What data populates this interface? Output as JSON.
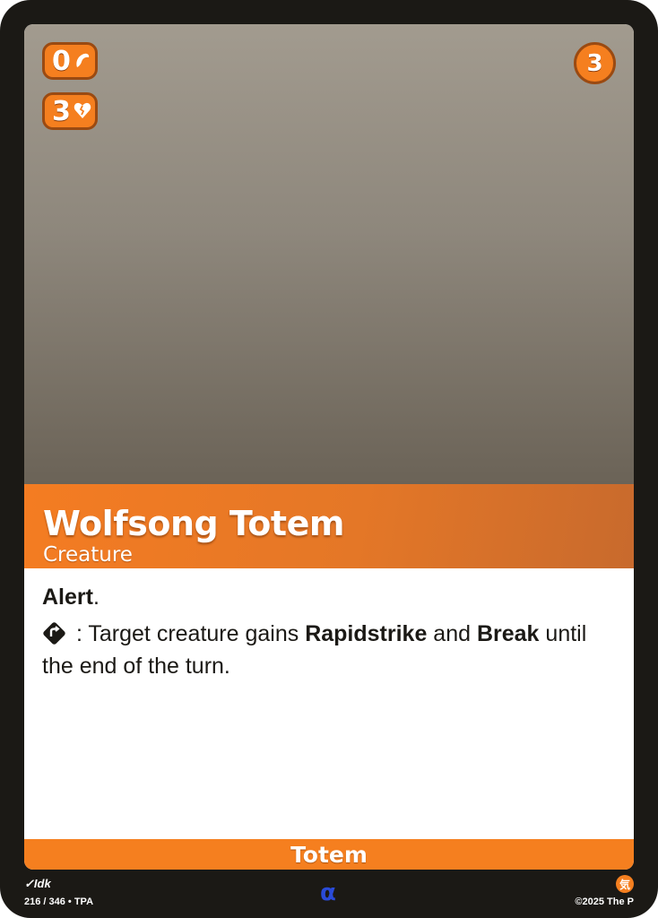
{
  "card": {
    "name": "Wolfsong Totem",
    "supertype": "Creature",
    "type_line": "Totem",
    "cost": "3",
    "stats": {
      "power": "0",
      "power_icon": "claw-icon",
      "life": "3",
      "life_icon": "broken-heart-icon"
    },
    "cost_icon": "element-symbol-icon",
    "rules": {
      "keyword": "Alert",
      "keyword_suffix": ".",
      "ability_icon": "exhaust-icon",
      "ability_sep": " : Target creature gains ",
      "kw2": "Rapidstrike",
      "mid": " and ",
      "kw3": "Break",
      "end": " until the end of the turn."
    }
  },
  "footer": {
    "artist": "Idk",
    "collector_number": "216 / 346 • TPA",
    "rarity_symbol": "α",
    "element_glyph": "気",
    "copyright": "©2025 The P"
  },
  "colors": {
    "accent": "#f57f1f",
    "border": "#1b1915",
    "rarity": "#2a4bd8"
  }
}
